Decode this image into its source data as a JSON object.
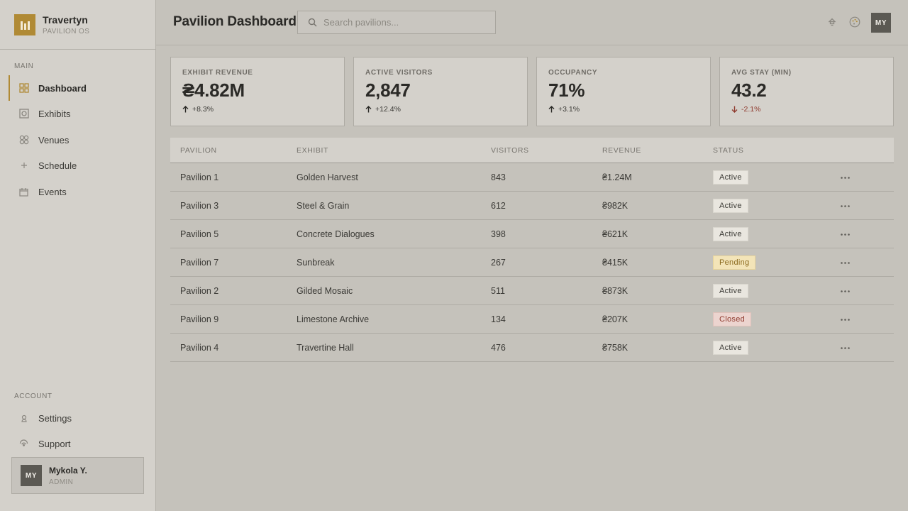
{
  "brand": {
    "name": "Travertyn",
    "subtitle": "PAVILION OS"
  },
  "sidebar": {
    "main_label": "MAIN",
    "main_items": [
      {
        "label": "Dashboard",
        "icon": "grid-icon",
        "active": true
      },
      {
        "label": "Exhibits",
        "icon": "frame-icon",
        "active": false
      },
      {
        "label": "Venues",
        "icon": "venues-icon",
        "active": false
      },
      {
        "label": "Schedule",
        "icon": "plus-icon",
        "active": false
      },
      {
        "label": "Events",
        "icon": "calendar-icon",
        "active": false
      }
    ],
    "account_label": "ACCOUNT",
    "account_items": [
      {
        "label": "Settings",
        "icon": "settings-icon"
      },
      {
        "label": "Support",
        "icon": "support-icon"
      }
    ],
    "user": {
      "initials": "MY",
      "name": "Mykola Y.",
      "role": "ADMIN"
    }
  },
  "header": {
    "title": "Pavilion Dashboard",
    "search_placeholder": "Search pavilions...",
    "avatar_initials": "MY"
  },
  "stats": [
    {
      "label": "EXHIBIT REVENUE",
      "value": "₴4.82M",
      "change": "+8.3%",
      "direction": "up"
    },
    {
      "label": "ACTIVE VISITORS",
      "value": "2,847",
      "change": "+12.4%",
      "direction": "up"
    },
    {
      "label": "OCCUPANCY",
      "value": "71%",
      "change": "+3.1%",
      "direction": "up"
    },
    {
      "label": "AVG STAY (MIN)",
      "value": "43.2",
      "change": "-2.1%",
      "direction": "down"
    }
  ],
  "table": {
    "columns": [
      "PAVILION",
      "EXHIBIT",
      "VISITORS",
      "REVENUE",
      "STATUS"
    ],
    "rows": [
      {
        "pavilion": "Pavilion 1",
        "exhibit": "Golden Harvest",
        "visitors": "843",
        "revenue": "₴1.24M",
        "status": "Active"
      },
      {
        "pavilion": "Pavilion 3",
        "exhibit": "Steel & Grain",
        "visitors": "612",
        "revenue": "₴982K",
        "status": "Active"
      },
      {
        "pavilion": "Pavilion 5",
        "exhibit": "Concrete Dialogues",
        "visitors": "398",
        "revenue": "₴621K",
        "status": "Active"
      },
      {
        "pavilion": "Pavilion 7",
        "exhibit": "Sunbreak",
        "visitors": "267",
        "revenue": "₴415K",
        "status": "Pending"
      },
      {
        "pavilion": "Pavilion 2",
        "exhibit": "Gilded Mosaic",
        "visitors": "511",
        "revenue": "₴873K",
        "status": "Active"
      },
      {
        "pavilion": "Pavilion 9",
        "exhibit": "Limestone Archive",
        "visitors": "134",
        "revenue": "₴207K",
        "status": "Closed"
      },
      {
        "pavilion": "Pavilion 4",
        "exhibit": "Travertine Hall",
        "visitors": "476",
        "revenue": "₴758K",
        "status": "Active"
      }
    ]
  },
  "colors": {
    "accent": "#b08a35",
    "background": "#c5c2bb",
    "panel": "#d4d1cb",
    "status_active": "#e9e6df",
    "status_pending": "#f3e4b8",
    "status_closed": "#ecd4cf",
    "negative": "#8f3a2e"
  }
}
